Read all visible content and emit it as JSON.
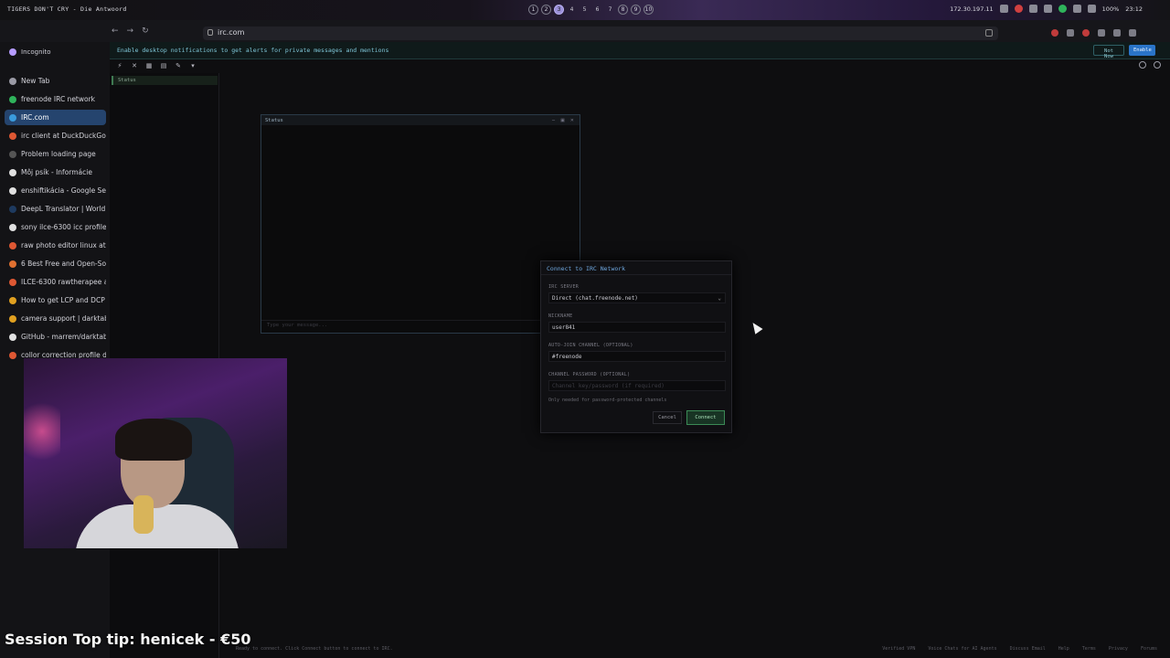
{
  "system_bar": {
    "now_playing": "TIGERS DON'T CRY - Die Antwoord",
    "workspaces": [
      "1",
      "2",
      "3",
      "4",
      "5",
      "6",
      "7",
      "8",
      "9",
      "10"
    ],
    "active_workspace": "3",
    "ip": "172.30.197.11",
    "battery": "100%",
    "time": "23:12"
  },
  "browser": {
    "url": "irc.com",
    "incognito_label": "Incognito",
    "tabs": [
      {
        "label": "New Tab",
        "color": "#9a9aa5"
      },
      {
        "label": "freenode IRC network",
        "color": "#2fb35b"
      },
      {
        "label": "IRC.com",
        "color": "#3a9bdc",
        "active": true
      },
      {
        "label": "irc client at DuckDuckGo",
        "color": "#de5833"
      },
      {
        "label": "Problem loading page",
        "color": "#555"
      },
      {
        "label": "Môj psík - Informácie",
        "color": "#e0e0e0"
      },
      {
        "label": "enshiftikácia - Google Sea",
        "color": "#e0e0e0"
      },
      {
        "label": "DeepL Translator | World",
        "color": "#1e3a5f"
      },
      {
        "label": "sony ilce-6300 icc profile",
        "color": "#e0e0e0"
      },
      {
        "label": "raw photo editor linux at",
        "color": "#de5833"
      },
      {
        "label": "6 Best Free and Open-Sou",
        "color": "#e07030"
      },
      {
        "label": "ILCE-6300 rawtherapee at",
        "color": "#de5833"
      },
      {
        "label": "How to get LCP and DCP p",
        "color": "#e0a020"
      },
      {
        "label": "camera support | darktab",
        "color": "#e0a020"
      },
      {
        "label": "GitHub - marrem/darktab",
        "color": "#e0e0e0"
      },
      {
        "label": "collor correction profile d",
        "color": "#de5833"
      }
    ]
  },
  "notification": {
    "message": "Enable desktop notifications to get alerts for private messages and mentions",
    "not_now": "Not Now",
    "enable": "Enable"
  },
  "sidebar": {
    "status_label": "Status"
  },
  "status_window": {
    "title": "Status",
    "input_placeholder": "Type your message..."
  },
  "dialog": {
    "title": "Connect to IRC Network",
    "server_label": "IRC SERVER",
    "server_value": "Direct (chat.freenode.net)",
    "nickname_label": "NICKNAME",
    "nickname_value": "user841",
    "autojoin_label": "AUTO-JOIN CHANNEL (OPTIONAL)",
    "autojoin_value": "#freenode",
    "password_label": "CHANNEL PASSWORD (OPTIONAL)",
    "password_placeholder": "Channel key/password (if required)",
    "hint": "Only needed for password-protected channels",
    "cancel": "Cancel",
    "connect": "Connect"
  },
  "page_status": {
    "left": "Ready to connect. Click Connect button to connect to IRC.",
    "links": [
      "Verified VPN",
      "Voice Chats for AI Agents",
      "Discuss Email",
      "Help",
      "Terms",
      "Privacy",
      "Forums"
    ]
  },
  "overlay": {
    "top_tip": "Session Top tip: henicek - €50"
  }
}
